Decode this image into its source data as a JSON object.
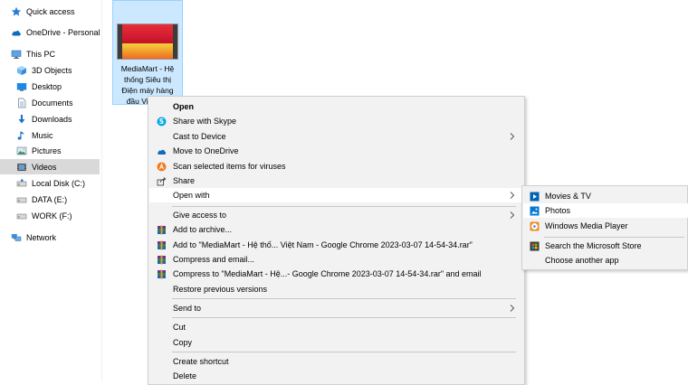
{
  "nav": {
    "items": [
      {
        "label": "Quick access",
        "icon": "star-icon"
      },
      {
        "label": "OneDrive - Personal",
        "icon": "cloud-icon"
      },
      {
        "label": "This PC",
        "icon": "computer-icon"
      },
      {
        "label": "3D Objects",
        "icon": "cube-icon"
      },
      {
        "label": "Desktop",
        "icon": "desktop-icon"
      },
      {
        "label": "Documents",
        "icon": "document-icon"
      },
      {
        "label": "Downloads",
        "icon": "download-icon"
      },
      {
        "label": "Music",
        "icon": "music-icon"
      },
      {
        "label": "Pictures",
        "icon": "pictures-icon"
      },
      {
        "label": "Videos",
        "icon": "videos-icon"
      },
      {
        "label": "Local Disk (C:)",
        "icon": "drive-icon"
      },
      {
        "label": "DATA (E:)",
        "icon": "drive-icon"
      },
      {
        "label": "WORK (F:)",
        "icon": "drive-icon"
      },
      {
        "label": "Network",
        "icon": "network-icon"
      }
    ],
    "selected": "Videos"
  },
  "file": {
    "name": "MediaMart - Hệ thống Siêu thị Điện máy hàng đầu Việt N..."
  },
  "context_menu": {
    "items": [
      {
        "label": "Open",
        "bold": true
      },
      {
        "label": "Share with Skype",
        "icon": "skype-icon"
      },
      {
        "label": "Cast to Device",
        "submenu": true
      },
      {
        "label": "Move to OneDrive",
        "icon": "onedrive-icon"
      },
      {
        "label": "Scan selected items for viruses",
        "icon": "antivirus-icon"
      },
      {
        "label": "Share",
        "icon": "share-icon"
      },
      {
        "label": "Open with",
        "submenu": true,
        "highlighted": true
      },
      {
        "label": "Give access to",
        "submenu": true
      },
      {
        "label": "Add to archive...",
        "icon": "winrar-icon"
      },
      {
        "label": "Add to \"MediaMart - Hệ thố... Việt Nam - Google Chrome 2023-03-07 14-54-34.rar\"",
        "icon": "winrar-icon"
      },
      {
        "label": "Compress and email...",
        "icon": "winrar-icon"
      },
      {
        "label": "Compress to \"MediaMart - Hệ...- Google Chrome 2023-03-07 14-54-34.rar\" and email",
        "icon": "winrar-icon"
      },
      {
        "label": "Restore previous versions"
      },
      {
        "label": "Send to",
        "submenu": true
      },
      {
        "label": "Cut"
      },
      {
        "label": "Copy"
      },
      {
        "label": "Create shortcut"
      },
      {
        "label": "Delete"
      }
    ]
  },
  "open_with_menu": {
    "items": [
      {
        "label": "Movies & TV",
        "icon": "movies-tv-icon"
      },
      {
        "label": "Photos",
        "icon": "photos-icon",
        "highlighted": true
      },
      {
        "label": "Windows Media Player",
        "icon": "media-player-icon"
      },
      {
        "label": "Search the Microsoft Store",
        "icon": "store-icon"
      },
      {
        "label": "Choose another app"
      }
    ]
  },
  "colors": {
    "accent": "#0078d7",
    "selection": "#cce8ff",
    "menu_bg": "#f2f2f2",
    "nav_selected": "#d9d9d9"
  }
}
